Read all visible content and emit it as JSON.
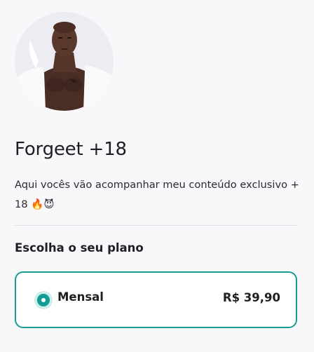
{
  "profile": {
    "name": "Forgeet +18",
    "bio": "Aqui vocês vão acompanhar meu conteúdo exclusivo + 18 🔥😈",
    "avatar_alt": "profile-photo"
  },
  "plans": {
    "title": "Escolha o seu plano",
    "items": [
      {
        "label": "Mensal",
        "price": "R$ 39,90",
        "selected": true
      }
    ]
  },
  "colors": {
    "accent": "#199b91",
    "background": "#f8f8fb",
    "text": "#1f1f24"
  }
}
